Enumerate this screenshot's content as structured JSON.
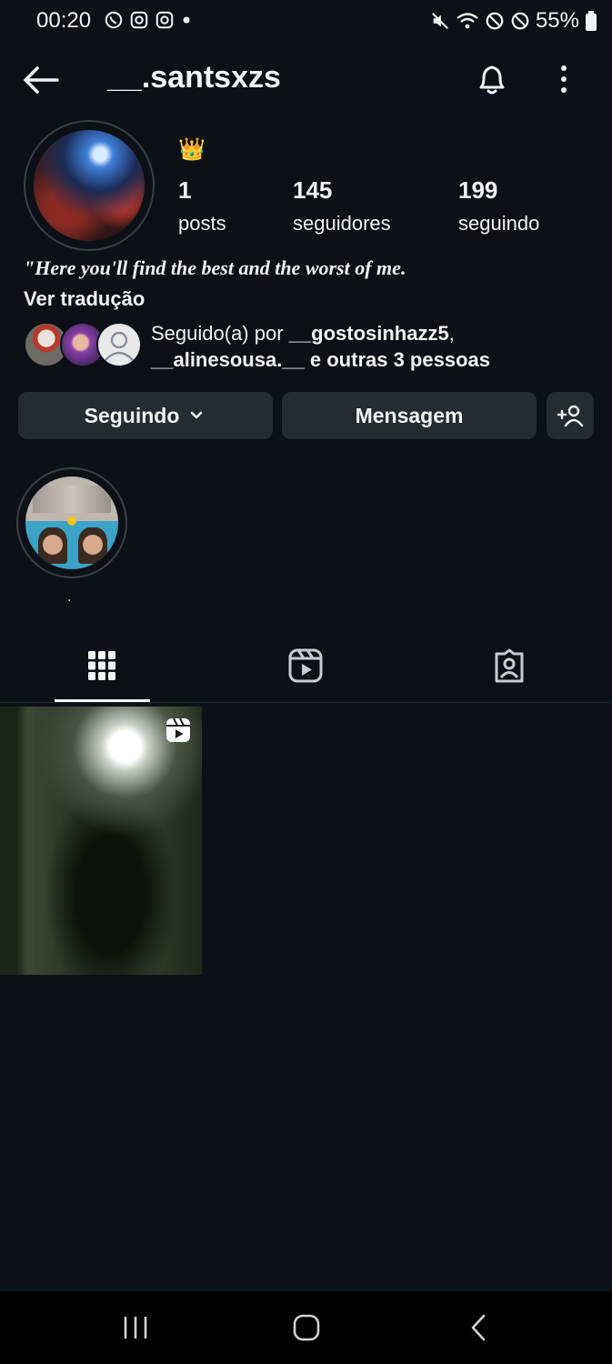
{
  "status_bar": {
    "time": "00:20",
    "battery": "55%"
  },
  "header": {
    "username": "__.santsxzs"
  },
  "profile": {
    "crown": "👑",
    "stats": [
      {
        "value": "1",
        "label": "posts"
      },
      {
        "value": "145",
        "label": "seguidores"
      },
      {
        "value": "199",
        "label": "seguindo"
      }
    ],
    "bio": "\"Here you'll find the best and the worst of me.",
    "translate": "Ver tradução",
    "followed_prefix": "Seguido(a) por ",
    "followed_user1": "__gostosinhazz5",
    "followed_comma": ",",
    "followed_user2": "__alinesousa.__",
    "followed_suffix": " e outras 3 pessoas"
  },
  "buttons": {
    "following": "Seguindo",
    "message": "Mensagem"
  },
  "highlight": {
    "label": "."
  },
  "icons": {
    "back": "arrow-left-icon",
    "bell": "bell-icon",
    "more": "more-vertical-icon",
    "grid": "grid-icon",
    "reels": "reels-icon",
    "tagged": "tagged-icon",
    "add_person": "add-person-icon"
  }
}
